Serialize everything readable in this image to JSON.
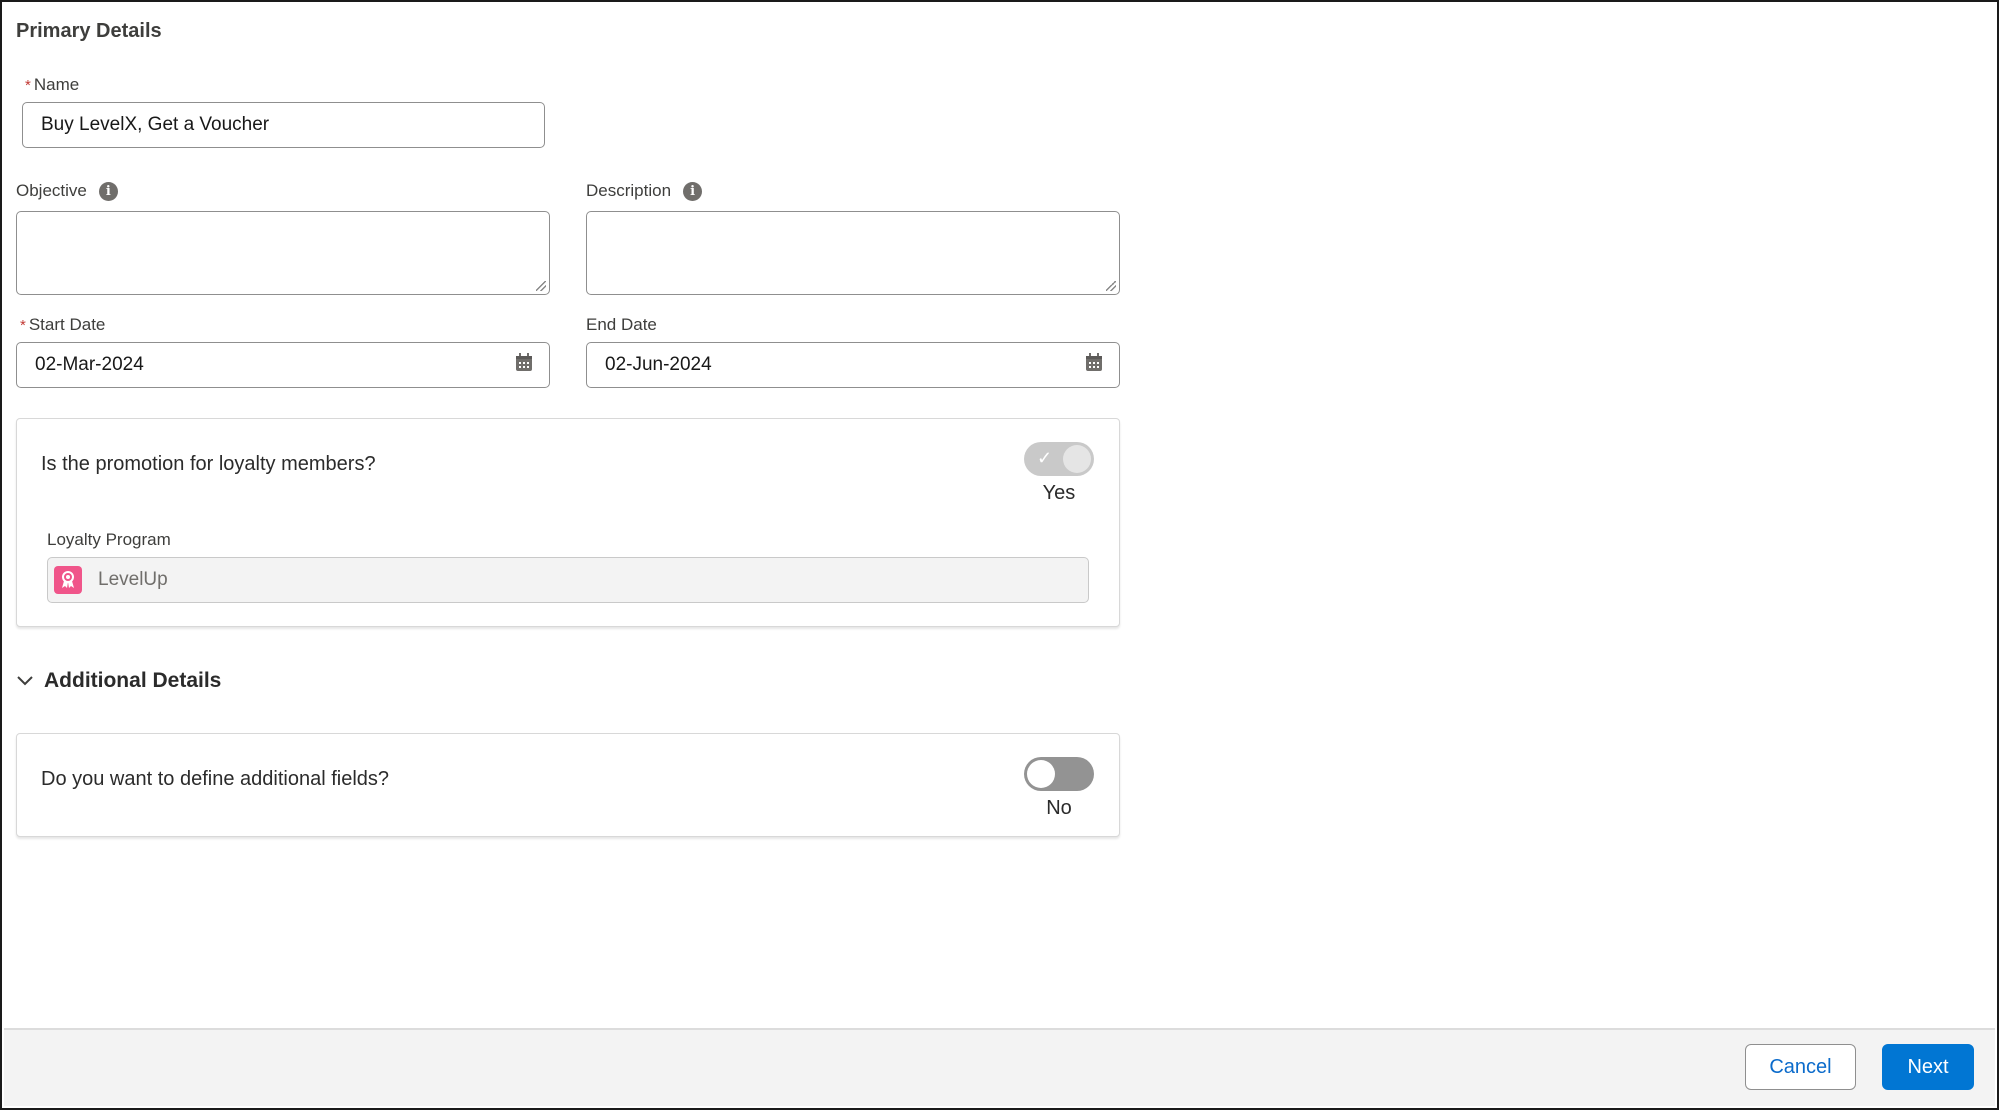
{
  "primary_details": {
    "title": "Primary Details",
    "name": {
      "label": "Name",
      "required": true,
      "value": "Buy LevelX, Get a Voucher"
    },
    "objective": {
      "label": "Objective",
      "info_icon": "info-icon",
      "value": ""
    },
    "description": {
      "label": "Description",
      "info_icon": "info-icon",
      "value": ""
    },
    "start_date": {
      "label": "Start Date",
      "required": true,
      "value": "02-Mar-2024",
      "icon": "calendar-icon"
    },
    "end_date": {
      "label": "End Date",
      "value": "02-Jun-2024",
      "icon": "calendar-icon"
    }
  },
  "loyalty_card": {
    "question": "Is the promotion for loyalty members?",
    "toggle_state": "on",
    "toggle_text": "Yes",
    "program_label": "Loyalty Program",
    "program_value": "LevelUp",
    "program_icon": "loyalty-badge-icon",
    "program_icon_color": "#f0558a"
  },
  "additional_details": {
    "title": "Additional Details",
    "expanded": true,
    "question": "Do you want to define additional fields?",
    "toggle_state": "off",
    "toggle_text": "No"
  },
  "footer": {
    "cancel_label": "Cancel",
    "next_label": "Next",
    "brand_color": "#0176d3"
  }
}
